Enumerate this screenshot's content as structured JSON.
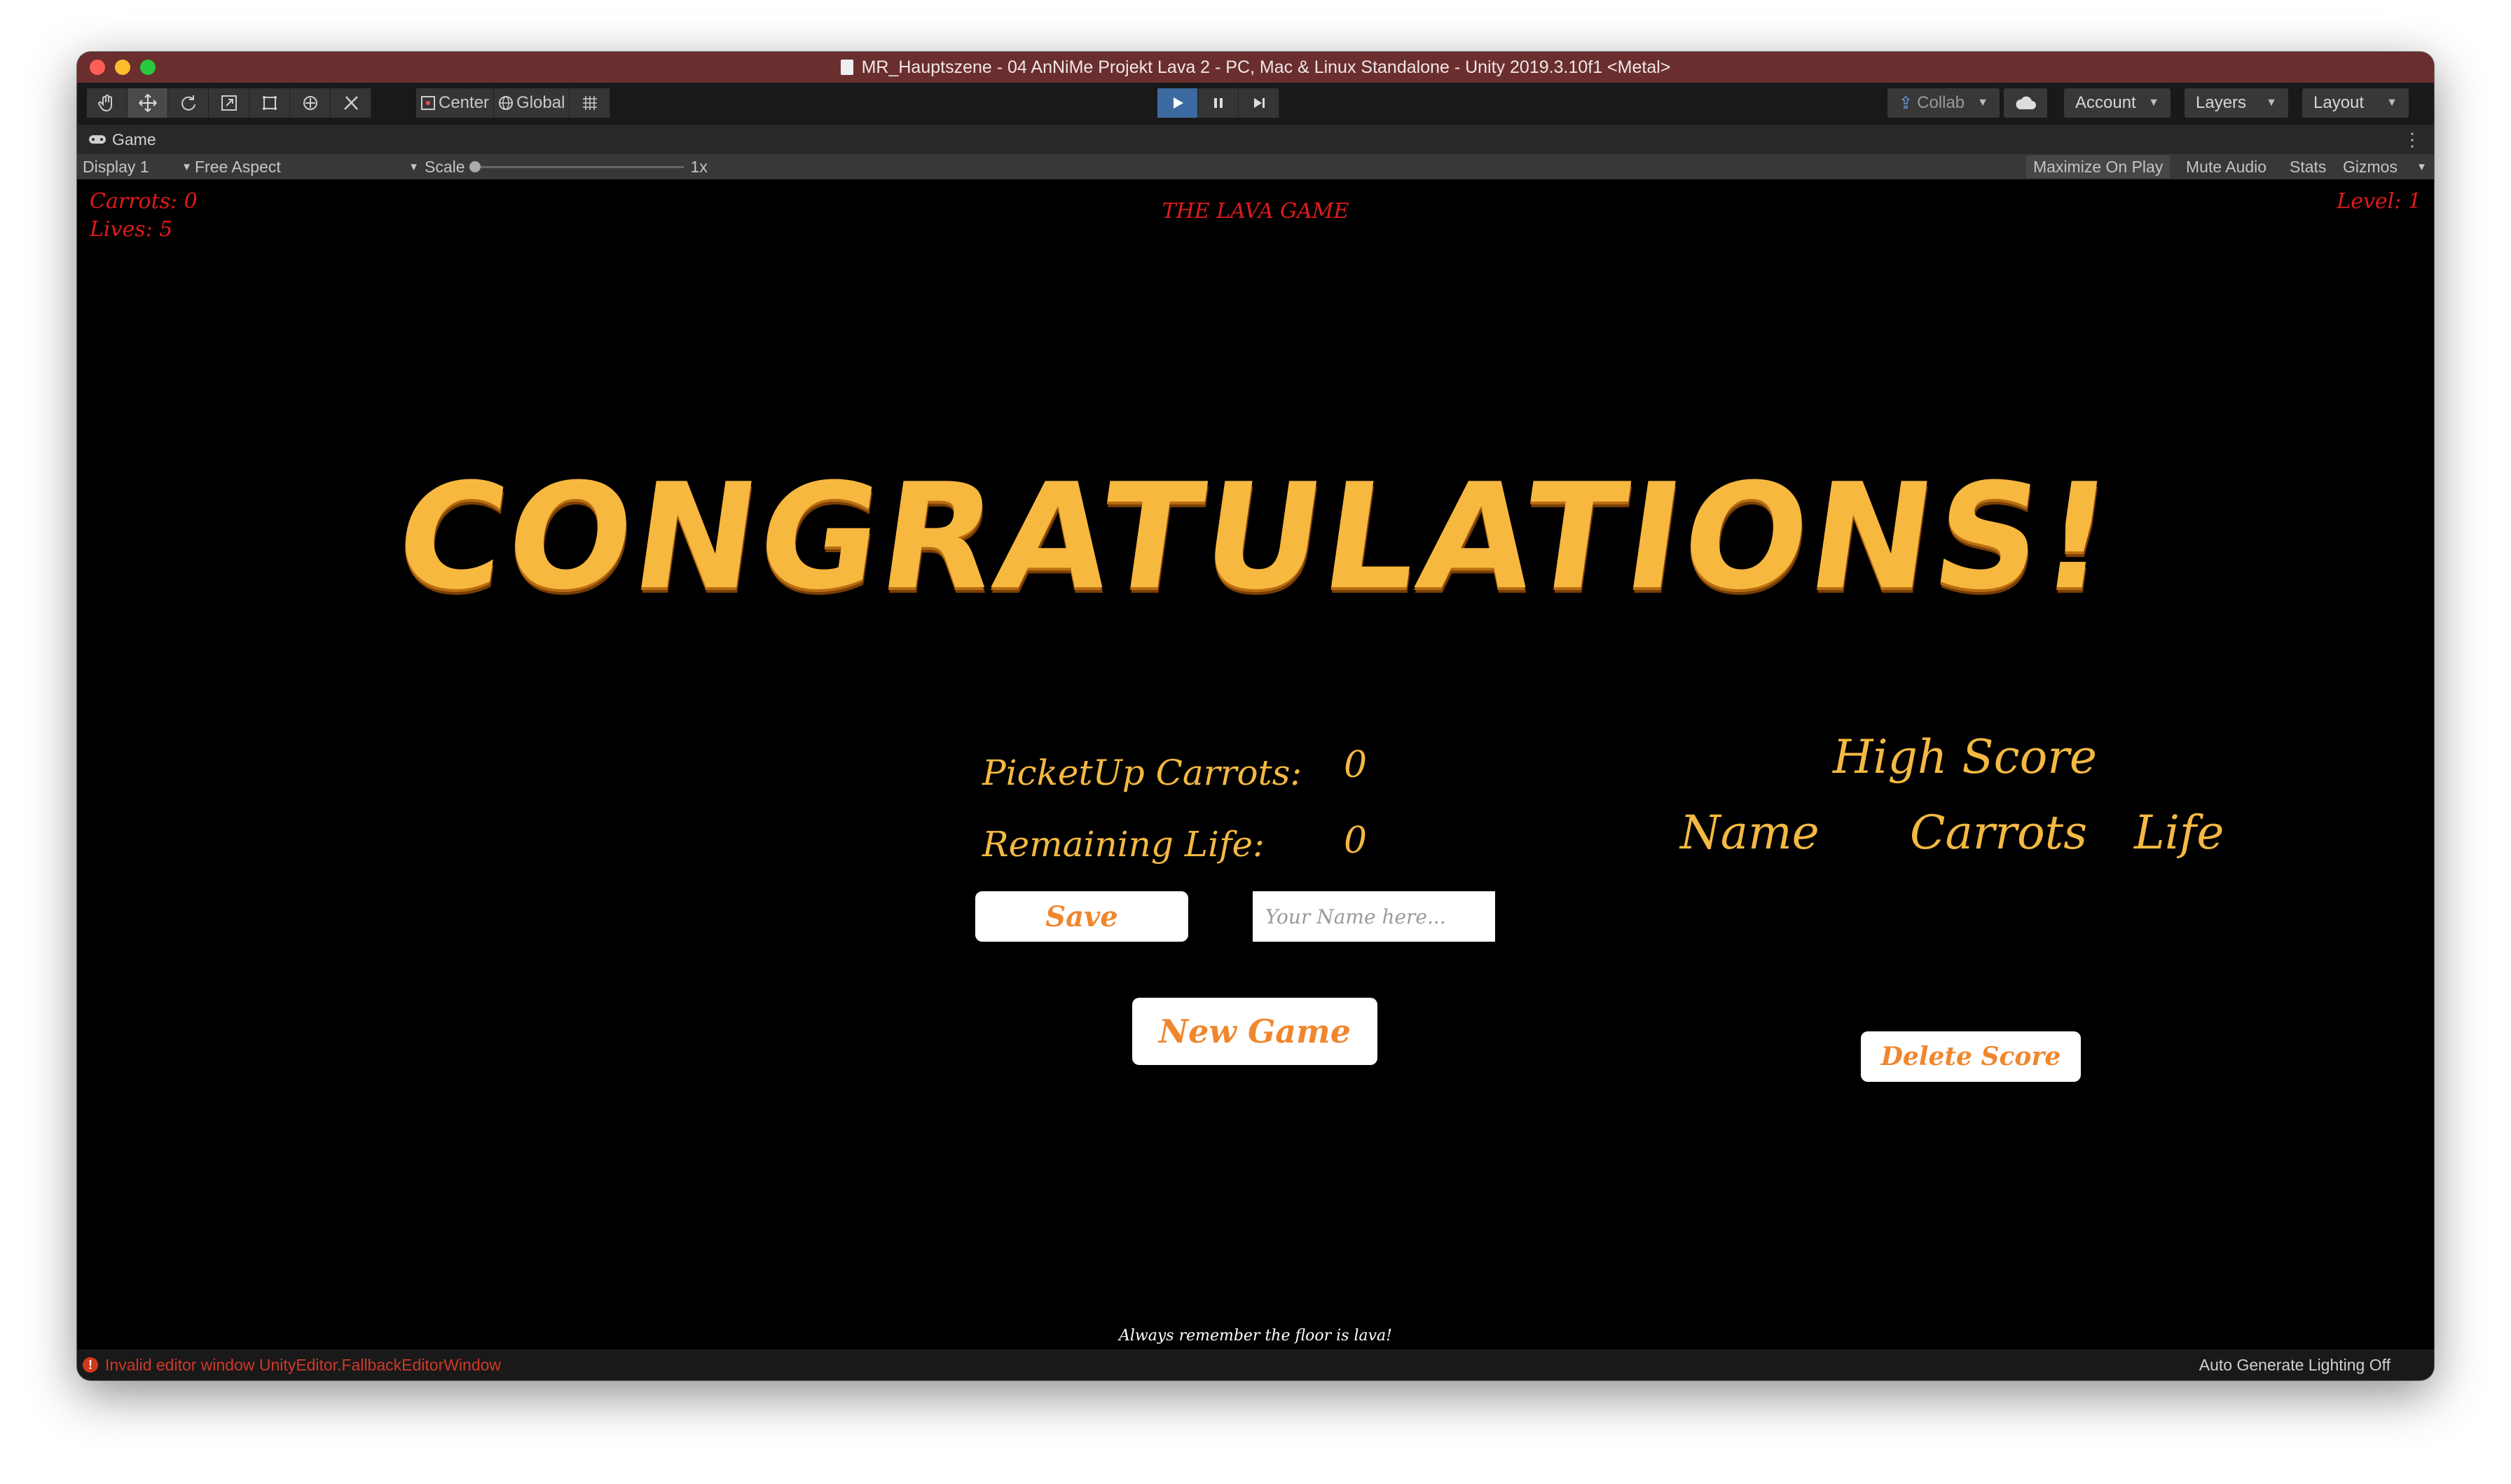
{
  "window": {
    "title": "MR_Hauptszene - 04 AnNiMe Projekt Lava 2 - PC, Mac & Linux Standalone - Unity 2019.3.10f1 <Metal>"
  },
  "toolbar": {
    "tools": [
      "hand-tool",
      "move-tool",
      "rotate-tool",
      "scale-tool",
      "rect-tool",
      "transform-tool",
      "custom-tool"
    ],
    "pivot_label": "Center",
    "space_label": "Global",
    "collab_label": "Collab",
    "account_label": "Account",
    "layers_label": "Layers",
    "layout_label": "Layout"
  },
  "tabbar": {
    "game_tab": "Game"
  },
  "controls": {
    "display": "Display 1",
    "aspect": "Free Aspect",
    "scale_label": "Scale",
    "scale_value": "1x",
    "scale_level": 0,
    "maximize": "Maximize On Play",
    "mute": "Mute Audio",
    "stats": "Stats",
    "gizmos": "Gizmos"
  },
  "game": {
    "carrots_hud": "Carrots: 0",
    "lives_hud": "Lives: 5",
    "title": "THE LAVA GAME",
    "level_hud": "Level: 1",
    "headline": "CONGRATULATIONS!",
    "picked_label": "PicketUp Carrots:",
    "picked_value": "0",
    "life_label": "Remaining Life:",
    "life_value": "0",
    "save_button": "Save",
    "name_placeholder": "Your Name here...",
    "new_game_button": "New Game",
    "highscore_title": "High Score",
    "col_name": "Name",
    "col_carrots": "Carrots",
    "col_life": "Life",
    "delete_button": "Delete Score",
    "footer": "Always remember the floor is lava!"
  },
  "status": {
    "error": "Invalid editor window UnityEditor.FallbackEditorWindow",
    "lighting": "Auto Generate Lighting Off"
  },
  "colors": {
    "hud_red": "#e01b1b",
    "gold": "#f4b942",
    "button_text": "#f0872e",
    "titlebar": "#6a2e2e"
  }
}
